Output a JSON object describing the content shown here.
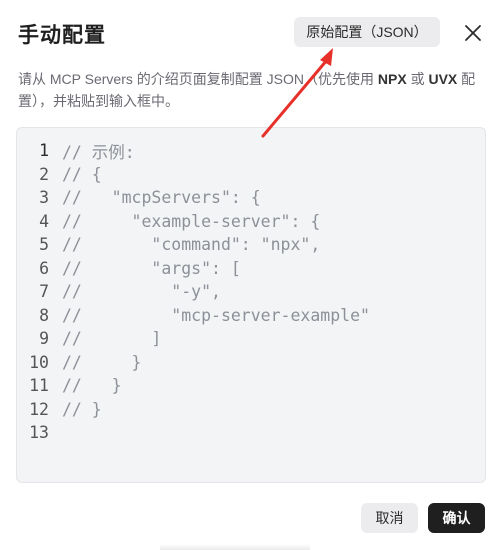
{
  "dialog": {
    "title": "手动配置",
    "raw_config_button": "原始配置（JSON）",
    "close_icon": "close-icon"
  },
  "description": {
    "part1": "请从 MCP Servers 的介绍页面复制配置 JSON（优先使用 ",
    "npx": "NPX",
    "or": " 或 ",
    "uvx": "UVX",
    "part2": " 配置），并粘贴到输入框中。"
  },
  "editor": {
    "lines": [
      {
        "num": "1",
        "text": "// 示例:"
      },
      {
        "num": "2",
        "text": "// {"
      },
      {
        "num": "3",
        "text": "//   \"mcpServers\": {"
      },
      {
        "num": "4",
        "text": "//     \"example-server\": {"
      },
      {
        "num": "5",
        "text": "//       \"command\": \"npx\","
      },
      {
        "num": "6",
        "text": "//       \"args\": ["
      },
      {
        "num": "7",
        "text": "//         \"-y\","
      },
      {
        "num": "8",
        "text": "//         \"mcp-server-example\""
      },
      {
        "num": "9",
        "text": "//       ]"
      },
      {
        "num": "10",
        "text": "//     }"
      },
      {
        "num": "11",
        "text": "//   }"
      },
      {
        "num": "12",
        "text": "// }"
      },
      {
        "num": "13",
        "text": ""
      }
    ]
  },
  "footer": {
    "cancel_label": "取消",
    "confirm_label": "确认"
  },
  "colors": {
    "annotation_arrow": "#e8302a",
    "confirm_button_bg": "#1f1f1f",
    "editor_bg": "#f3f4f6"
  }
}
